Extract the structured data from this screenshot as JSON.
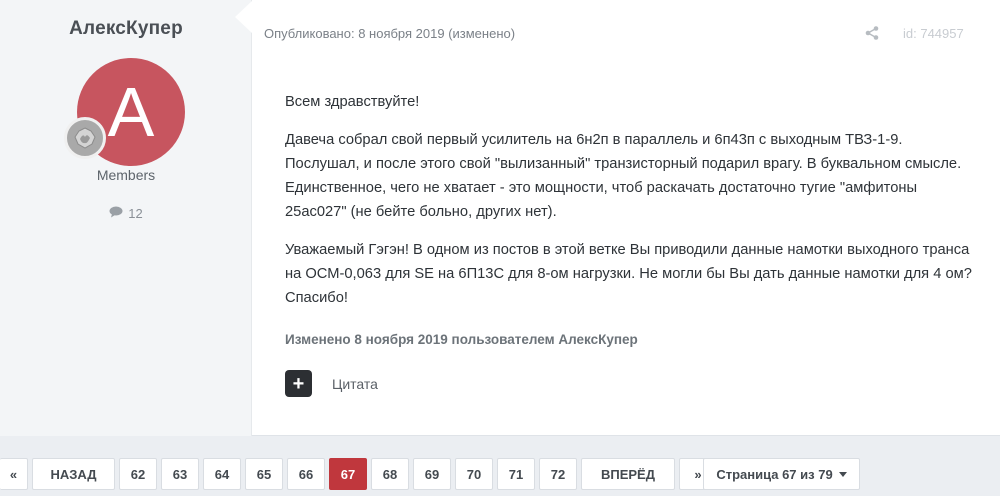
{
  "author": {
    "name": "АлексКупер",
    "avatar_letter": "A",
    "avatar_color": "#c7555f",
    "group": "Members",
    "post_count": "12",
    "badge_icon": "rank-badge-icon"
  },
  "post": {
    "meta": "Опубликовано: 8 ноября 2019 (изменено)",
    "post_id": "id: 744957",
    "share_icon": "share-icon",
    "paragraphs": [
      "Всем здравствуйте!",
      "Давеча собрал свой первый усилитель на 6н2п в параллель и 6п43п с выходным ТВЗ-1-9. Послушал, и после этого свой \"вылизанный\" транзисторный подарил врагу. В буквальном смысле. Единственное, чего не хватает - это мощности, чтоб раскачать достаточно тугие \"амфитоны 25ас027\" (не бейте больно, других нет).",
      "Уважаемый Гэгэн! В одном из постов в этой ветке Вы приводили данные намотки выходного транса на ОСМ-0,063 для SE на 6П13С для 8-ом нагрузки. Не могли бы Вы дать данные намотки для 4 ом?  Спасибо!"
    ],
    "edited_note": "Изменено 8 ноября 2019 пользователем АлексКупер",
    "add_label": "+",
    "quote_label": "Цитата"
  },
  "pagination": {
    "first": "«",
    "prev": "НАЗАД",
    "pages": [
      "62",
      "63",
      "64",
      "65",
      "66",
      "67",
      "68",
      "69",
      "70",
      "71",
      "72"
    ],
    "current": "67",
    "next": "ВПЕРЁД",
    "last": "»",
    "jump_label": "Страница 67 из 79"
  },
  "colors": {
    "accent": "#c0373d",
    "author_bg": "#f3f5f7"
  }
}
